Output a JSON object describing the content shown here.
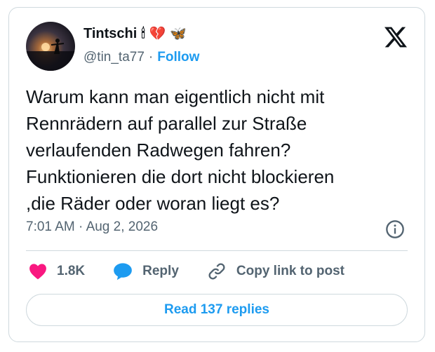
{
  "author": {
    "name": "Tintschi",
    "emojis": [
      "🕯",
      "💔",
      "🦋"
    ],
    "handle": "@tin_ta77",
    "separator": "·",
    "follow_label": "Follow"
  },
  "tweet": {
    "lines": [
      "Warum kann man eigentlich nicht mit",
      "Rennrädern auf parallel zur Straße",
      "verlaufenden Radwegen fahren?",
      "Funktionieren die dort nicht blockieren",
      ",die Räder oder woran liegt es?"
    ],
    "time": "7:01 AM",
    "separator": "·",
    "date": "Aug 2, 2026"
  },
  "actions": {
    "likes_count": "1.8K",
    "reply_label": "Reply",
    "copy_link_label": "Copy link to post"
  },
  "read_replies_label": "Read 137 replies",
  "icons": {
    "logo": "x-logo-icon",
    "like": "heart-icon",
    "reply": "speech-bubble-icon",
    "copy": "link-icon",
    "info": "info-icon"
  },
  "colors": {
    "accent": "#1d9bf0",
    "heart": "#f91880",
    "text": "#0f1419",
    "muted": "#536471",
    "border": "#cfd9de"
  }
}
